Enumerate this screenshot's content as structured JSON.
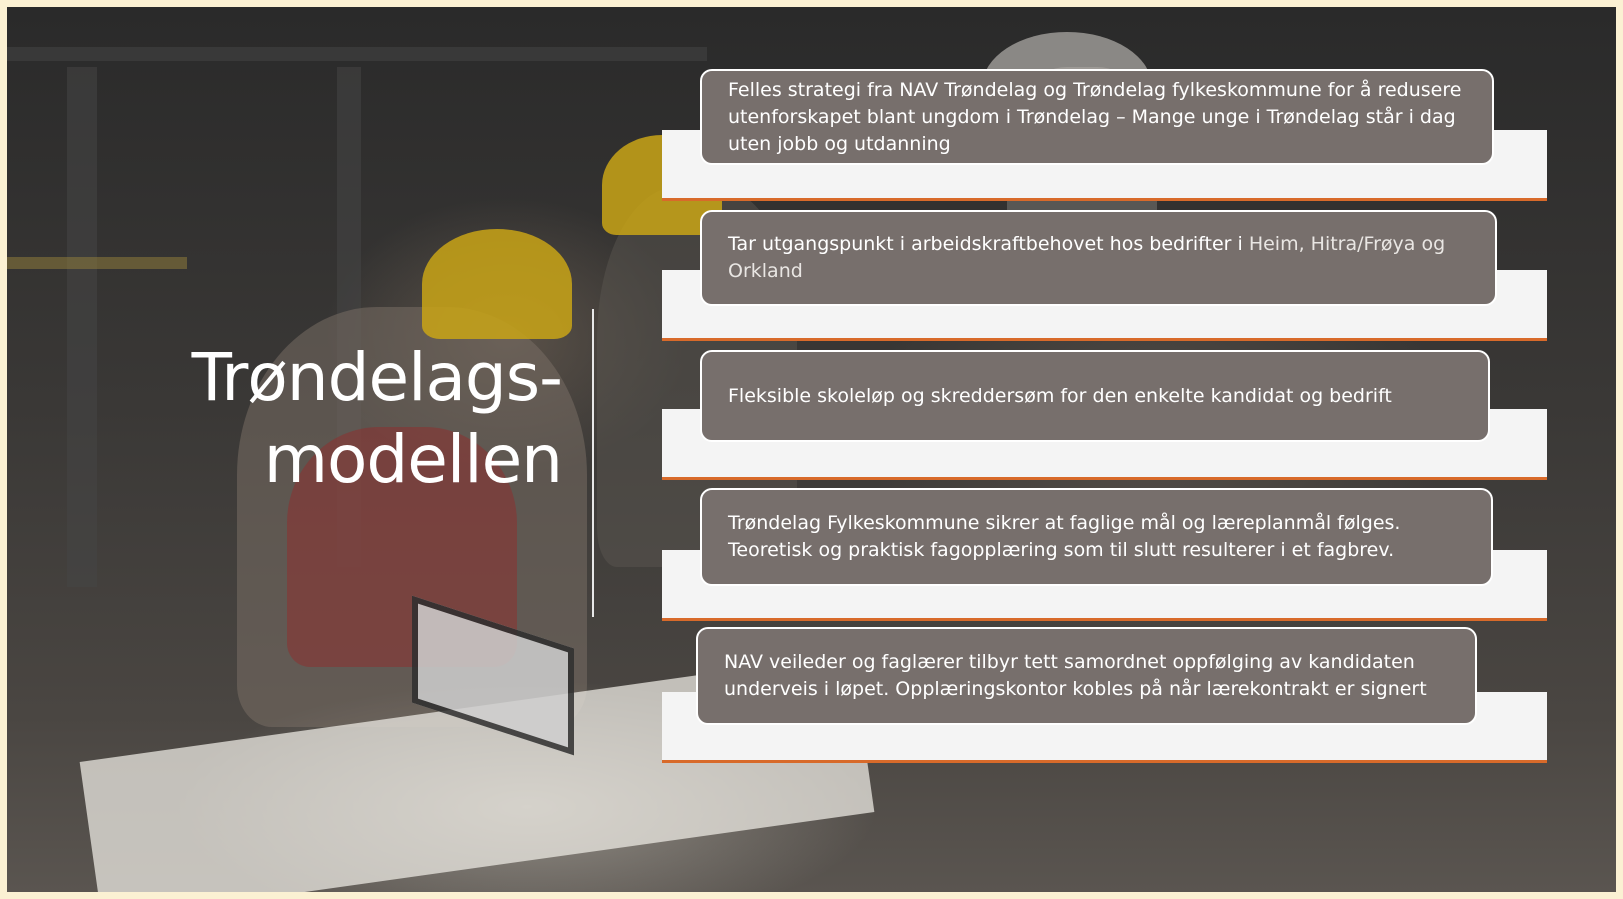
{
  "slide": {
    "title_line1": "Trøndelags-",
    "title_line2": "modellen"
  },
  "items": [
    {
      "text": "Felles strategi fra NAV Trøndelag og Trøndelag fylkeskommune for å redusere utenforskapet blant ungdom i Trøndelag – Mange unge i Trøndelag står i dag uten jobb og utdanning"
    },
    {
      "text": "Tar utgangspunkt i arbeidskraftbehovet hos bedrifter i ",
      "text_light": "Heim, Hitra/Frøya og Orkland"
    },
    {
      "text": "Fleksible skoleløp og skreddersøm for den enkelte kandidat og bedrift"
    },
    {
      "text": "Trøndelag Fylkeskommune sikrer at faglige mål og læreplanmål følges. Teoretisk og praktisk fagopplæring som til slutt resulterer i et fagbrev."
    },
    {
      "text": "NAV veileder og faglærer tilbyr tett samordnet oppfølging av kandidaten underveis i løpet. Opplæringskontor kobles på når lærekontrakt er signert"
    }
  ],
  "colors": {
    "card_fill": "#776f6c",
    "band_fill": "#f4f4f4",
    "band_accent": "#d86a2a",
    "helmet": "#c9a516"
  }
}
